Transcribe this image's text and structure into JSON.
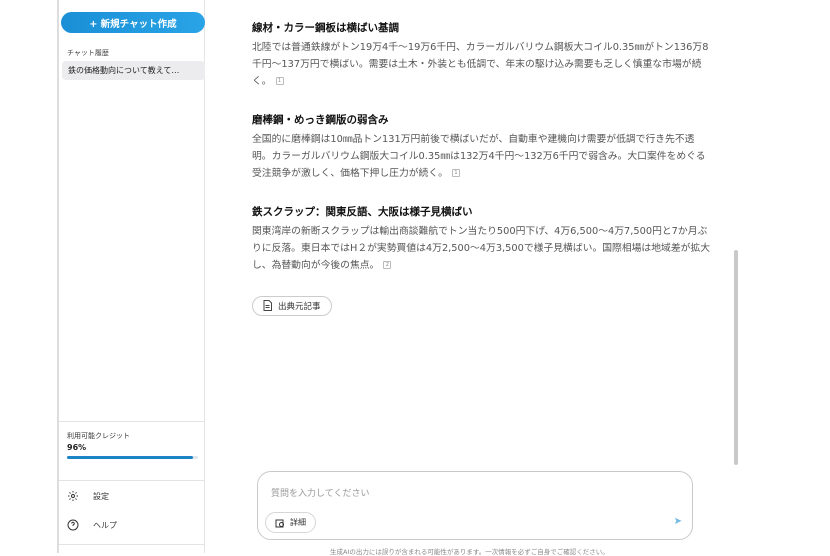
{
  "sidebar": {
    "new_chat": "+ 新規チャット作成",
    "history_label": "チャット履歴",
    "history_items": [
      "鉄の価格動向について教えて…"
    ],
    "credit_label": "利用可能クレジット",
    "credit_value": "96%",
    "credit_fraction": 0.96,
    "settings": "設定",
    "help": "ヘルプ"
  },
  "main": {
    "sections": [
      {
        "title": "線材・カラー鋼板は横ばい基調",
        "body": "北陸では普通鉄線がトン19万4千～19万6千円、カラーガルバリウム鋼板大コイル0.35㎜がトン136万8千円～137万円で横ばい。需要は土木・外装とも低調で、年末の駆け込み需要も乏しく慎重な市場が続く。",
        "cite": "1"
      },
      {
        "title": "磨棒鋼・めっき鋼版の弱含み",
        "body": "全国的に磨棒鋼は10㎜品トン131万円前後で横ばいだが、自動車や建機向け需要が低調で行き先不透明。カラーガルバリウム鋼版大コイル0.35㎜は132万4千円～132万6千円で弱含み。大口案件をめぐる受注競争が激しく、価格下押し圧力が続く。",
        "cite": "1"
      },
      {
        "title": "鉄スクラップ：関東反語、大阪は様子見横ばい",
        "body": "関東湾岸の新断スクラップは輸出商談難航でトン当たり500円下げ、4万6,500～4万7,500円と7か月ぶりに反落。東日本ではH２が実勢買値は4万2,500～4万3,500で様子見横ばい。国際相場は地域差が拡大し、為替動向が今後の焦点。",
        "cite": "2"
      }
    ],
    "source_button": "出典元記事"
  },
  "composer": {
    "placeholder": "質問を入力してください",
    "detail_button": "詳細",
    "send": "➤"
  },
  "footer": "生成AIの出力には誤りが含まれる可能性があります。一次情報を必ずご自身でご確認ください。"
}
